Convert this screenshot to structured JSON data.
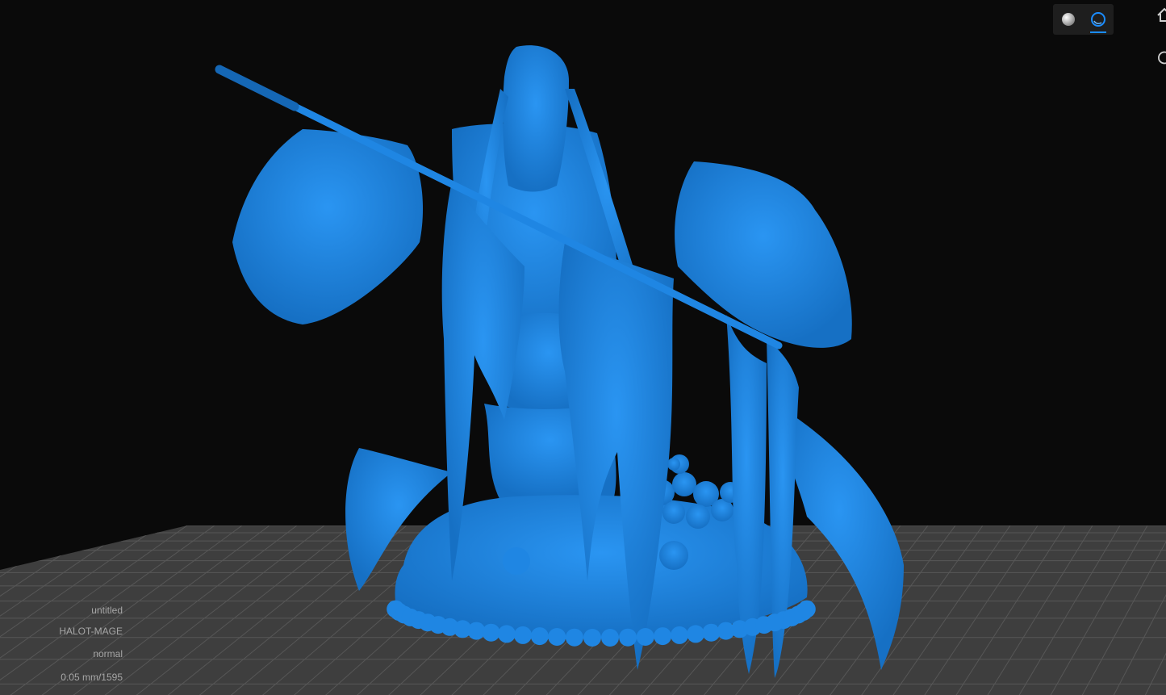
{
  "viewport": {
    "background": "#0a0a0a",
    "plate_color": "#3e3e3e",
    "grid_color": "#575757",
    "model_color": "#1f86e3"
  },
  "view_toggle": {
    "solid_icon": "solid-sphere-icon",
    "xray_icon": "xray-sphere-icon",
    "active": "xray",
    "accent": "#1a8cff"
  },
  "edge_icons": [
    "home-icon",
    "rotate-icon"
  ],
  "info": {
    "file_name": "untitled",
    "printer": "HALOT-MAGE",
    "mode": "normal",
    "layer_info": "0.05 mm/1595"
  }
}
